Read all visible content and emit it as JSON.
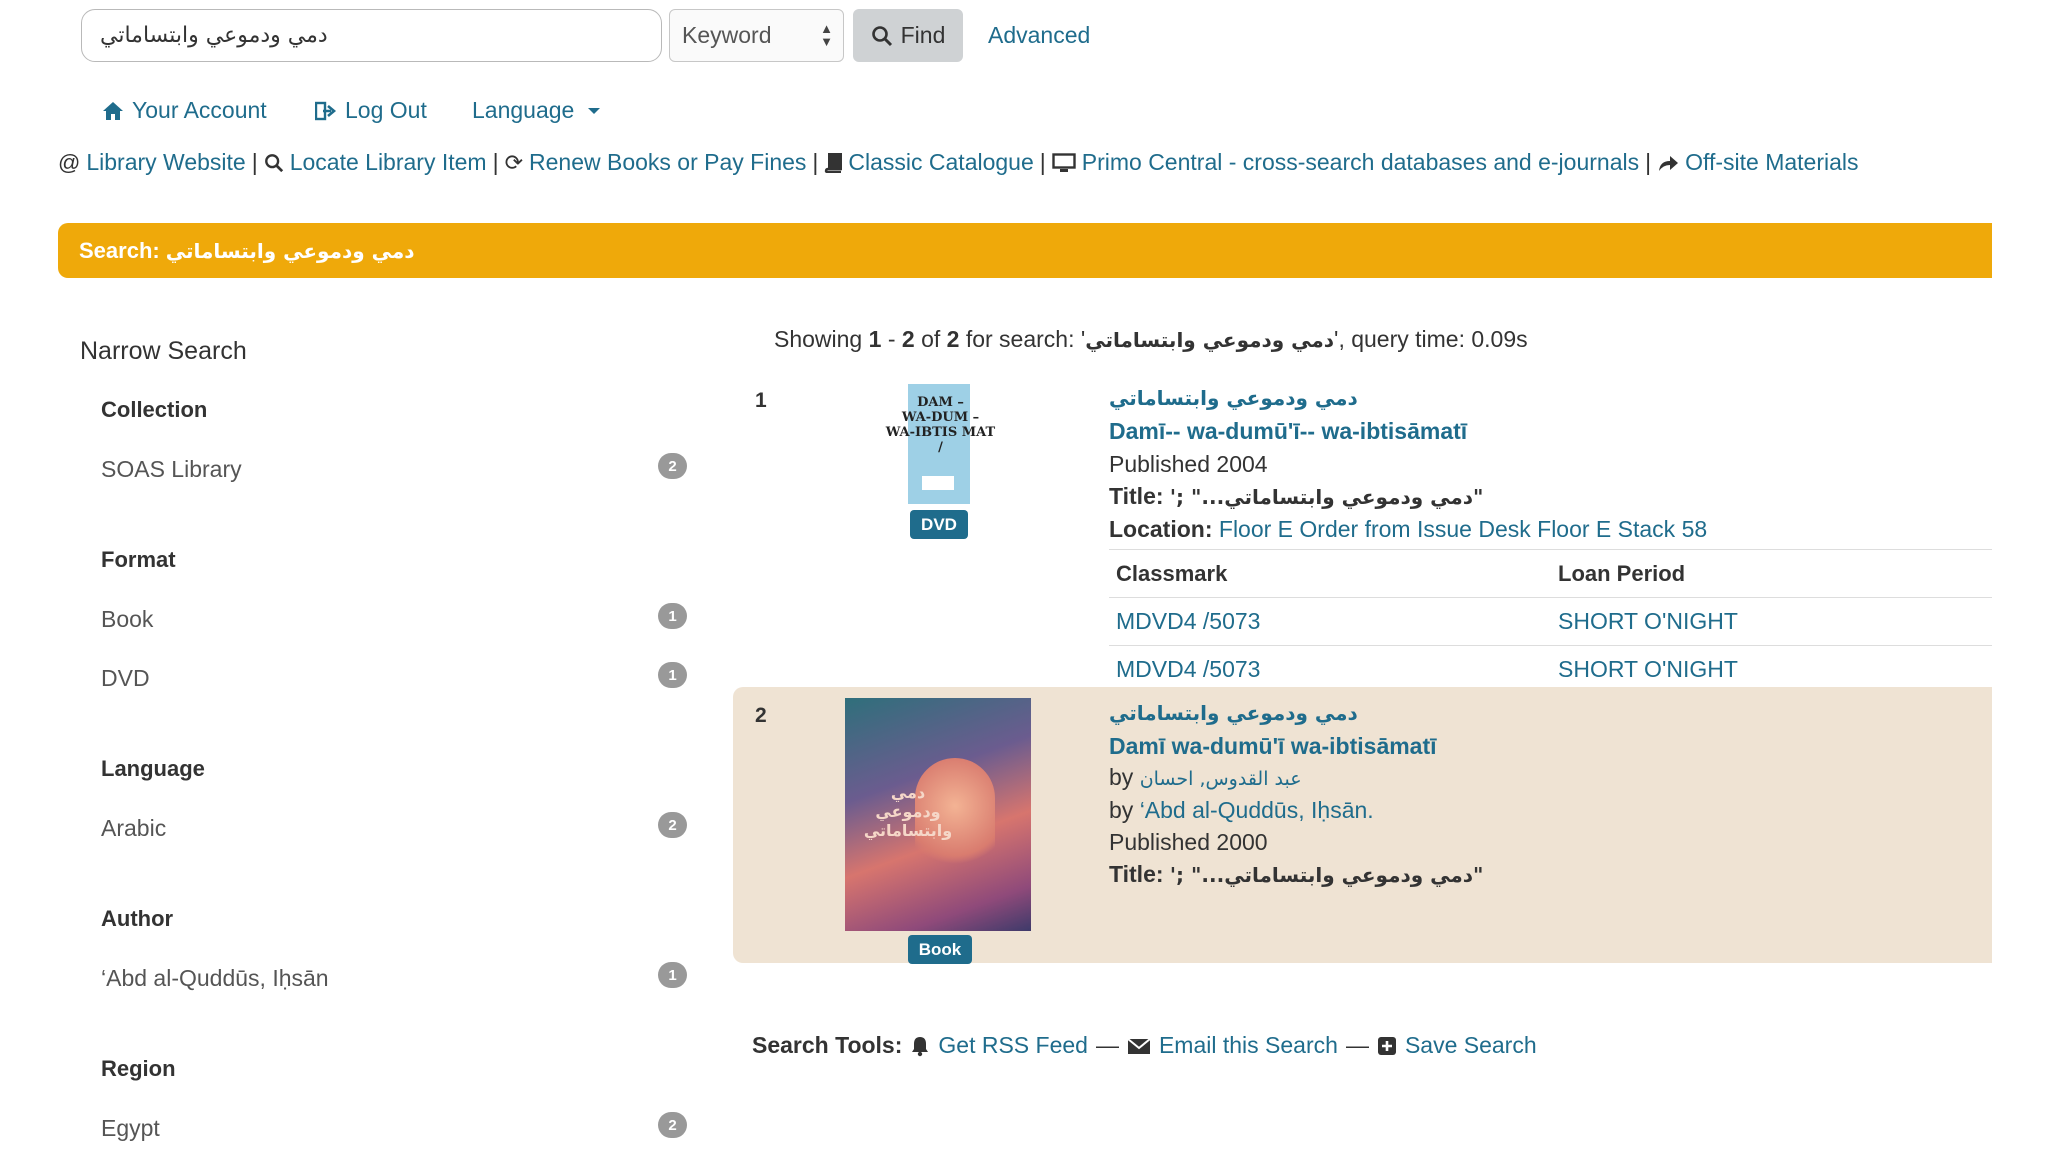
{
  "search": {
    "query": "دمي ودموعي وابتساماتي",
    "type_selected": "Keyword",
    "find_label": "Find",
    "advanced_label": "Advanced"
  },
  "account_nav": {
    "your_account": "Your Account",
    "log_out": "Log Out",
    "language": "Language"
  },
  "links": [
    {
      "icon": "at-icon",
      "label": "Library Website"
    },
    {
      "icon": "search-icon",
      "label": "Locate Library Item"
    },
    {
      "icon": "refresh-icon",
      "label": "Renew Books or Pay Fines"
    },
    {
      "icon": "book-icon",
      "label": "Classic Catalogue"
    },
    {
      "icon": "monitor-icon",
      "label": "Primo Central - cross-search databases and e-journals"
    },
    {
      "icon": "share-icon",
      "label": "Off-site Materials"
    }
  ],
  "banner": {
    "prefix": "Search:",
    "query": "دمي ودموعي وابتساماتي"
  },
  "sidebar": {
    "title": "Narrow Search",
    "facets": [
      {
        "heading": "Collection",
        "items": [
          {
            "label": "SOAS Library",
            "count": "2"
          }
        ]
      },
      {
        "heading": "Format",
        "items": [
          {
            "label": "Book",
            "count": "1"
          },
          {
            "label": "DVD",
            "count": "1"
          }
        ]
      },
      {
        "heading": "Language",
        "items": [
          {
            "label": "Arabic",
            "count": "2"
          }
        ]
      },
      {
        "heading": "Author",
        "items": [
          {
            "label": "‘Abd al-Quddūs, Iḥsān",
            "count": "1"
          }
        ]
      },
      {
        "heading": "Region",
        "items": [
          {
            "label": "Egypt",
            "count": "2"
          }
        ]
      }
    ]
  },
  "results_header": {
    "showing": "Showing",
    "start": "1",
    "dash": "-",
    "end": "2",
    "of": "of",
    "total": "2",
    "for_search": "for search: '",
    "query": "دمي ودموعي وابتساماتي",
    "query_time": "', query time: 0.09s"
  },
  "results": [
    {
      "number": "1",
      "title_ar": "دمي ودموعي وابتساماتي",
      "title_lat": "Damī-- wa-dumū'ī-- wa-ibtisāmatī",
      "published": "Published 2004",
      "title_label": "Title:",
      "title_value": "'; \"...دمي ودموعي وابتساماتي\"",
      "location_label": "Location:",
      "location_value": "Floor E Order from Issue Desk Floor E Stack 58",
      "format": "DVD",
      "cover_text": [
        "DAM –",
        "WA-DUM –",
        "WA-IBTIS MAT",
        "/"
      ],
      "holdings": {
        "col1": "Classmark",
        "col2": "Loan Period",
        "rows": [
          {
            "classmark": "MDVD4 /5073",
            "loan": "SHORT O'NIGHT"
          },
          {
            "classmark": "MDVD4 /5073",
            "loan": "SHORT O'NIGHT"
          }
        ]
      }
    },
    {
      "number": "2",
      "title_ar": "دمي ودموعي وابتساماتي",
      "title_lat": "Damī wa-dumū'ī wa-ibtisāmatī",
      "by_label": "by",
      "author_ar": "عبد القدوس, احسان",
      "author_lat": "‘Abd al-Quddūs, Iḥsān.",
      "published": "Published 2000",
      "title_label": "Title:",
      "title_value": "'; \"...دمي ودموعي وابتساماتي\"",
      "format": "Book",
      "cover_text": "دمي ودموعي وابتساماتي"
    }
  ],
  "search_tools": {
    "label": "Search Tools:",
    "rss": "Get RSS Feed",
    "email": "Email this Search",
    "save": "Save Search",
    "separator": "—"
  },
  "colors": {
    "link": "#1f6c8c",
    "banner": "#efa90a",
    "highlight_row": "#efe3d3",
    "badge": "#999999"
  }
}
